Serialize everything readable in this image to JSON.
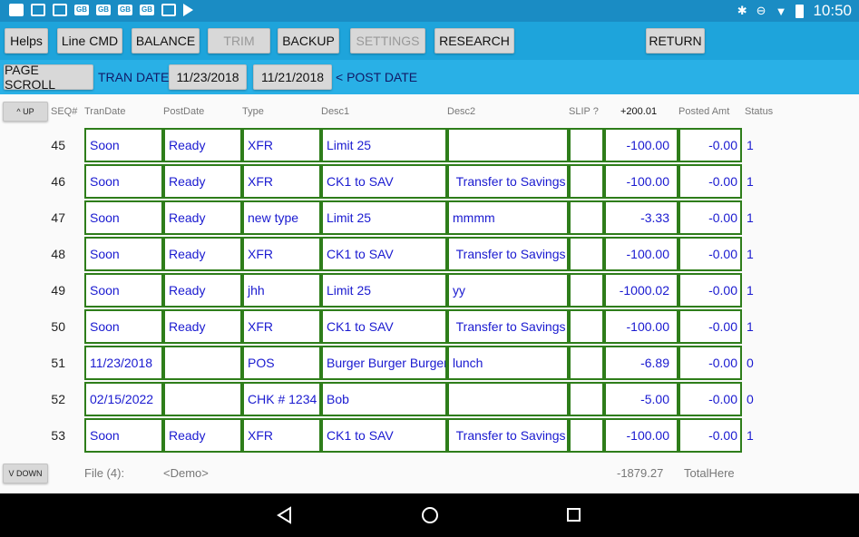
{
  "status_bar": {
    "time": "10:50",
    "icons": [
      "notification-icon",
      "gallery-icon",
      "mail-icon",
      "gb-icon",
      "gb-icon",
      "gb-icon",
      "gb-icon",
      "photo-icon",
      "play-store-icon",
      "bluetooth-icon",
      "dnd-icon",
      "wifi-icon",
      "battery-icon"
    ]
  },
  "toolbar": {
    "helps": "Helps",
    "line_cmd": "Line CMD",
    "balance": "BALANCE",
    "trim": "TRIM",
    "backup": "BACKUP",
    "settings": "SETTINGS",
    "research": "RESEARCH",
    "return": "RETURN"
  },
  "date_bar": {
    "page_scroll": "PAGE SCROLL",
    "tran_date_label": "TRAN DATE>",
    "tran_date": "11/23/2018",
    "post_date": "11/21/2018",
    "post_date_label": "< POST DATE"
  },
  "table": {
    "up_label": "^ UP",
    "down_label": "V DOWN",
    "headers": {
      "seq": "SEQ#",
      "tran_date": "TranDate",
      "post_date": "PostDate",
      "type": "Type",
      "desc1": "Desc1",
      "desc2": "Desc2",
      "slip": "SLIP ?",
      "amount": "+200.01",
      "posted_amt": "Posted Amt",
      "status": "Status"
    },
    "rows": [
      {
        "seq": "45",
        "tran": "Soon",
        "post": "Ready",
        "type": "XFR",
        "desc1": "Limit 25",
        "desc2": "",
        "slip": "",
        "amount": "-100.00",
        "posted": "-0.00",
        "status": "1"
      },
      {
        "seq": "46",
        "tran": "Soon",
        "post": "Ready",
        "type": "XFR",
        "desc1": "CK1 to SAV",
        "desc2": " Transfer to Savings",
        "slip": "",
        "amount": "-100.00",
        "posted": "-0.00",
        "status": "1"
      },
      {
        "seq": "47",
        "tran": "Soon",
        "post": "Ready",
        "type": "new type",
        "desc1": "Limit 25",
        "desc2": "mmmm",
        "slip": "",
        "amount": "-3.33",
        "posted": "-0.00",
        "status": "1"
      },
      {
        "seq": "48",
        "tran": "Soon",
        "post": "Ready",
        "type": "XFR",
        "desc1": "CK1 to SAV",
        "desc2": " Transfer to Savings",
        "slip": "",
        "amount": "-100.00",
        "posted": "-0.00",
        "status": "1"
      },
      {
        "seq": "49",
        "tran": "Soon",
        "post": "Ready",
        "type": "jhh",
        "desc1": "Limit 25",
        "desc2": "yy",
        "slip": "",
        "amount": "-1000.02",
        "posted": "-0.00",
        "status": "1"
      },
      {
        "seq": "50",
        "tran": "Soon",
        "post": "Ready",
        "type": "XFR",
        "desc1": "CK1 to SAV",
        "desc2": " Transfer to Savings",
        "slip": "",
        "amount": "-100.00",
        "posted": "-0.00",
        "status": "1"
      },
      {
        "seq": "51",
        "tran": "11/23/2018",
        "post": "",
        "type": "POS",
        "desc1": "Burger Burger Burger",
        "desc2": "lunch",
        "slip": "",
        "amount": "-6.89",
        "posted": "-0.00",
        "status": "0"
      },
      {
        "seq": "52",
        "tran": "02/15/2022",
        "post": "",
        "type": "CHK # 1234",
        "desc1": "Bob",
        "desc2": "",
        "slip": "",
        "amount": "-5.00",
        "posted": "-0.00",
        "status": "0"
      },
      {
        "seq": "53",
        "tran": "Soon",
        "post": "Ready",
        "type": "XFR",
        "desc1": "CK1 to SAV",
        "desc2": " Transfer to Savings",
        "slip": "",
        "amount": "-100.00",
        "posted": "-0.00",
        "status": "1"
      }
    ]
  },
  "footer": {
    "file": "File (4):",
    "demo": "<Demo>",
    "total": "-1879.27",
    "total_label": "TotalHere"
  },
  "colors": {
    "status_bar": "#1a8cc4",
    "toolbar": "#1ea4db",
    "date_bar": "#29b0e6",
    "cell_border": "#2e7d1a",
    "cell_text": "#1a1ad0"
  }
}
